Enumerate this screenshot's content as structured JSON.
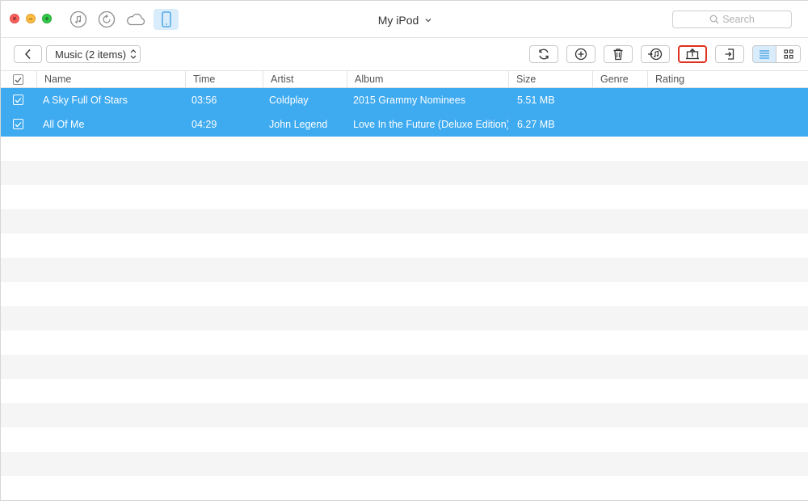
{
  "window": {
    "title": "My iPod",
    "search_placeholder": "Search"
  },
  "top_icons": [
    "music-icon",
    "restore-icon",
    "cloud-icon",
    "device-icon"
  ],
  "toolbar": {
    "category_label": "Music (2 items)",
    "buttons": [
      "refresh-icon",
      "add-icon",
      "delete-icon",
      "to-itunes-icon",
      "export-to-computer-icon",
      "import-icon"
    ],
    "highlight_color": "#e0301e",
    "view_mode": "list"
  },
  "table": {
    "columns": [
      "Name",
      "Time",
      "Artist",
      "Album",
      "Size",
      "Genre",
      "Rating"
    ],
    "rows": [
      {
        "name": "A Sky Full Of Stars",
        "time": "03:56",
        "artist": "Coldplay",
        "album": "2015 Grammy Nominees",
        "size": "5.51 MB",
        "genre": "",
        "rating": "",
        "checked": true
      },
      {
        "name": "All Of Me",
        "time": "04:29",
        "artist": "John Legend",
        "album": "Love In the Future (Deluxe Edition)",
        "size": "6.27 MB",
        "genre": "",
        "rating": "",
        "checked": true
      }
    ],
    "selection_color": "#3eaaf0"
  }
}
